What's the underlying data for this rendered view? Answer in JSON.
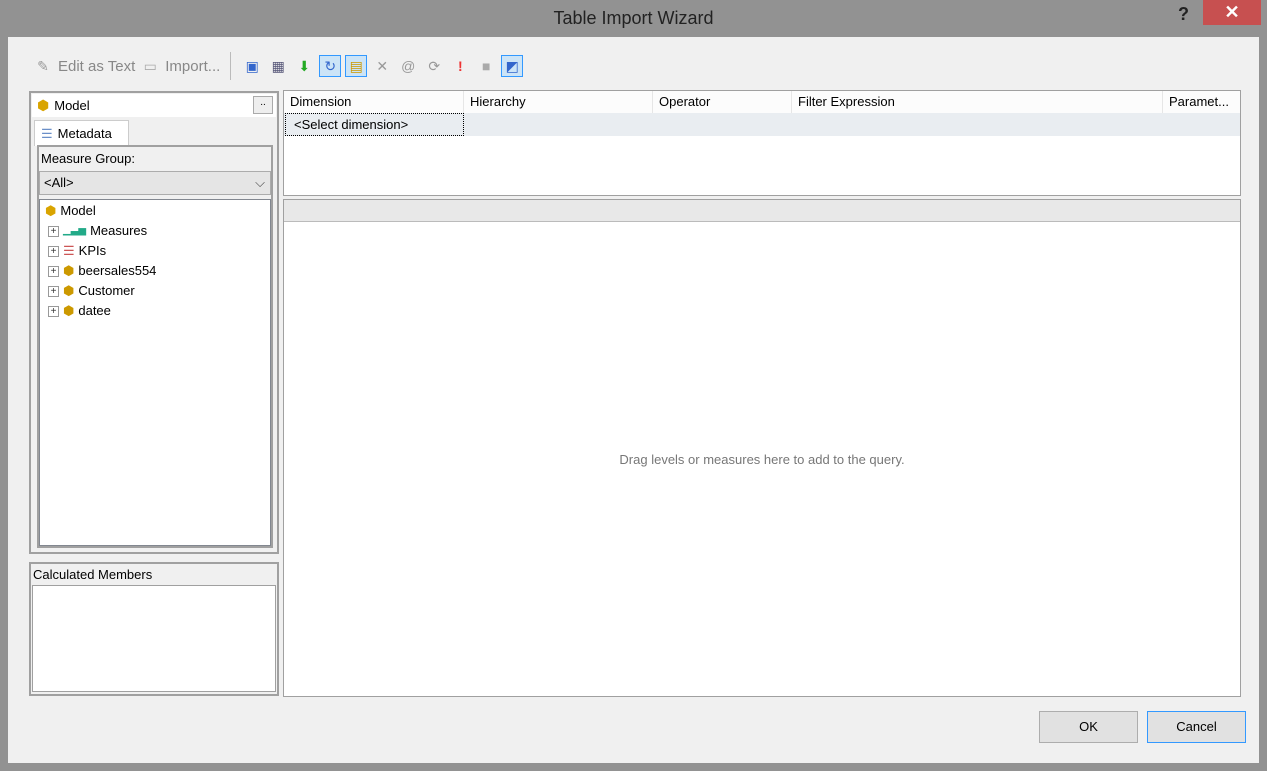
{
  "window": {
    "title": "Table Import Wizard",
    "help": "?",
    "close": "✕"
  },
  "toolbar": {
    "edit_as_text": "Edit as Text",
    "import": "Import..."
  },
  "left": {
    "cube": "Model",
    "browse": "..",
    "tab": "Metadata",
    "measure_group_label": "Measure Group:",
    "measure_group_value": "<All>",
    "tree": [
      {
        "label": "Model",
        "icon": "cube-icon"
      },
      {
        "label": "Measures",
        "icon": "measures-icon"
      },
      {
        "label": "KPIs",
        "icon": "kpi-icon"
      },
      {
        "label": "beersales554",
        "icon": "dimension-icon"
      },
      {
        "label": "Customer",
        "icon": "dimension-icon"
      },
      {
        "label": "datee",
        "icon": "dimension-icon"
      }
    ],
    "calculated_members": "Calculated Members"
  },
  "filter": {
    "columns": [
      "Dimension",
      "Hierarchy",
      "Operator",
      "Filter Expression",
      "Paramet..."
    ],
    "row": "<Select dimension>"
  },
  "query": {
    "placeholder": "Drag levels or measures here to add to the query."
  },
  "buttons": {
    "ok": "OK",
    "cancel": "Cancel"
  }
}
